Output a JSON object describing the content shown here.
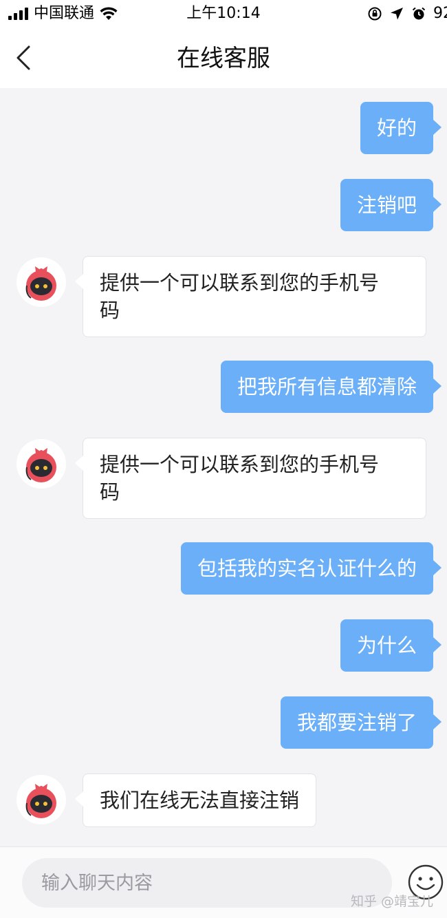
{
  "status_bar": {
    "carrier": "中国联通",
    "time": "上午10:14",
    "battery": "92"
  },
  "nav": {
    "title": "在线客服"
  },
  "messages": [
    {
      "side": "out",
      "text": "好的"
    },
    {
      "side": "out",
      "text": "注销吧"
    },
    {
      "side": "in",
      "line1": "提供一个可以联系到您的手机号",
      "line2": "码"
    },
    {
      "side": "out",
      "text": "把我所有信息都清除"
    },
    {
      "side": "in",
      "line1": "提供一个可以联系到您的手机号",
      "line2": "码"
    },
    {
      "side": "out",
      "text": "包括我的实名认证什么的"
    },
    {
      "side": "out",
      "text": "为什么"
    },
    {
      "side": "out",
      "text": "我都要注销了"
    },
    {
      "side": "in",
      "text": "我们在线无法直接注销"
    }
  ],
  "input": {
    "placeholder": "输入聊天内容"
  },
  "watermark": "知乎 @靖宝儿",
  "colors": {
    "outgoing_bubble": "#6aaff7",
    "incoming_bubble": "#ffffff",
    "background": "#f4f4f6"
  },
  "icons": {
    "back": "chevron-left-icon",
    "emoji": "smiley-icon",
    "avatar": "robot-avatar"
  }
}
